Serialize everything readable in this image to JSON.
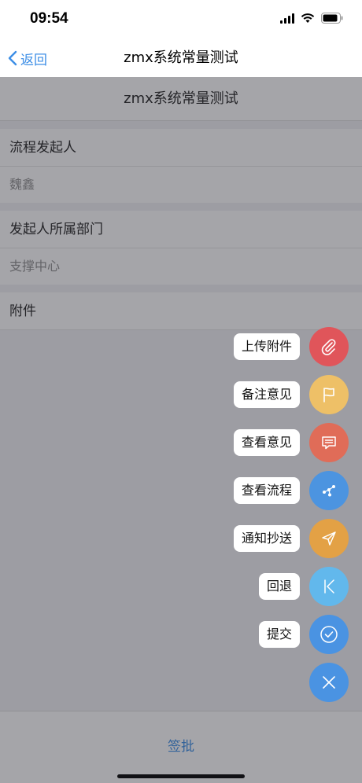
{
  "status": {
    "time": "09:54"
  },
  "nav": {
    "back_label": "返回",
    "title": "zmx系统常量测试"
  },
  "form": {
    "title": "zmx系统常量测试",
    "fields": [
      {
        "label": "流程发起人",
        "value": "魏鑫"
      },
      {
        "label": "发起人所属部门",
        "value": "支撑中心"
      },
      {
        "label": "附件",
        "value": ""
      }
    ]
  },
  "actions": [
    {
      "label": "上传附件",
      "icon": "paperclip-icon",
      "color": "#e0555a"
    },
    {
      "label": "备注意见",
      "icon": "flag-icon",
      "color": "#eec067"
    },
    {
      "label": "查看意见",
      "icon": "comment-icon",
      "color": "#e06c58"
    },
    {
      "label": "查看流程",
      "icon": "flow-icon",
      "color": "#4c94e0"
    },
    {
      "label": "通知抄送",
      "icon": "send-icon",
      "color": "#e3a145"
    },
    {
      "label": "回退",
      "icon": "back-step-icon",
      "color": "#62b8ec"
    },
    {
      "label": "提交",
      "icon": "check-icon",
      "color": "#4a93e2"
    },
    {
      "label": "",
      "icon": "close-icon",
      "color": "#4a93e2"
    }
  ],
  "bottom": {
    "sign_label": "签批"
  }
}
